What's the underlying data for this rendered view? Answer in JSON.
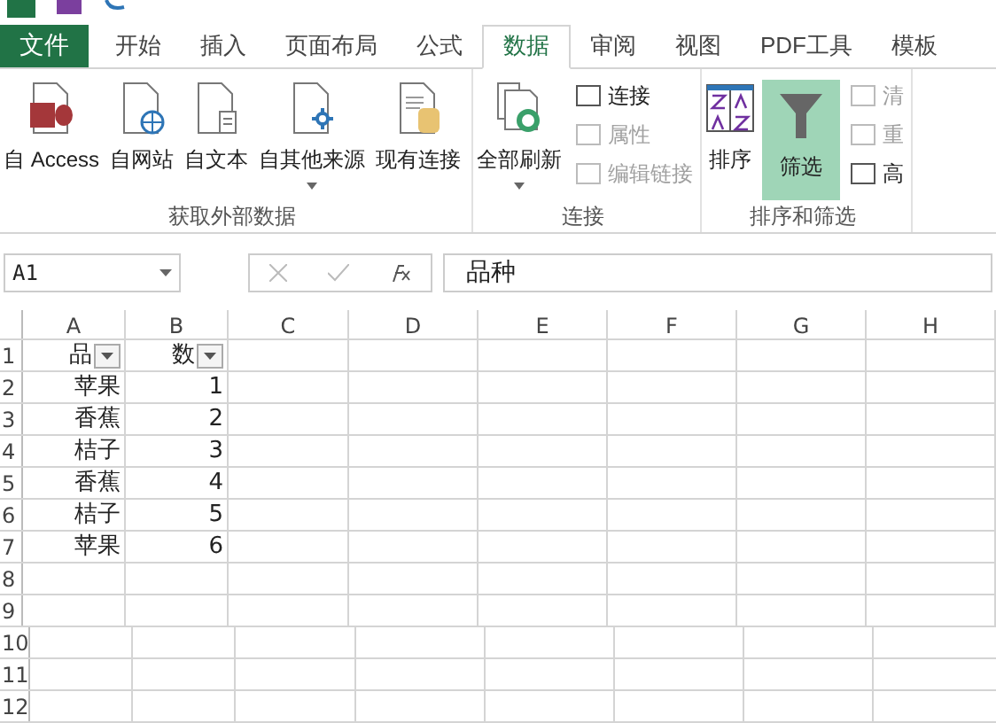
{
  "tabs": [
    {
      "label": "文件",
      "kind": "file",
      "selected": false
    },
    {
      "label": "开始",
      "kind": "tab",
      "selected": false
    },
    {
      "label": "插入",
      "kind": "tab",
      "selected": false
    },
    {
      "label": "页面布局",
      "kind": "tab",
      "selected": false
    },
    {
      "label": "公式",
      "kind": "tab",
      "selected": false
    },
    {
      "label": "数据",
      "kind": "tab",
      "selected": true
    },
    {
      "label": "审阅",
      "kind": "tab",
      "selected": false
    },
    {
      "label": "视图",
      "kind": "tab",
      "selected": false
    },
    {
      "label": "PDF工具",
      "kind": "tab",
      "selected": false
    },
    {
      "label": "模板",
      "kind": "tab",
      "selected": false
    }
  ],
  "ribbon": {
    "groups": [
      {
        "label": "获取外部数据",
        "buttons": [
          {
            "label": "自 Access",
            "dropdown": false
          },
          {
            "label": "自网站",
            "dropdown": false
          },
          {
            "label": "自文本",
            "dropdown": false
          },
          {
            "label": "自其他来源",
            "dropdown": true
          },
          {
            "label": "现有连接",
            "dropdown": false
          }
        ]
      },
      {
        "label": "连接",
        "buttons": [
          {
            "label": "全部刷新",
            "dropdown": true
          }
        ],
        "small": [
          {
            "label": "连接",
            "disabled": false
          },
          {
            "label": "属性",
            "disabled": true
          },
          {
            "label": "编辑链接",
            "disabled": true
          }
        ]
      },
      {
        "label": "排序和筛选",
        "buttons": [
          {
            "label": "排序",
            "dropdown": false,
            "selected": false
          },
          {
            "label": "筛选",
            "dropdown": false,
            "selected": true
          }
        ],
        "small": [
          {
            "label": "清",
            "disabled": true
          },
          {
            "label": "重",
            "disabled": true
          },
          {
            "label": "高",
            "disabled": false
          }
        ]
      }
    ]
  },
  "formula_bar": {
    "name_box": "A1",
    "value": "品种"
  },
  "sheet": {
    "columns": [
      "A",
      "B",
      "C",
      "D",
      "E",
      "F",
      "G",
      "H"
    ],
    "rows": [
      {
        "header": "1",
        "cells": [
          "品",
          "数"
        ],
        "filter": true
      },
      {
        "header": "2",
        "cells": [
          "苹果",
          "1"
        ]
      },
      {
        "header": "3",
        "cells": [
          "香蕉",
          "2"
        ]
      },
      {
        "header": "4",
        "cells": [
          "桔子",
          "3"
        ]
      },
      {
        "header": "5",
        "cells": [
          "香蕉",
          "4"
        ]
      },
      {
        "header": "6",
        "cells": [
          "桔子",
          "5"
        ]
      },
      {
        "header": "7",
        "cells": [
          "苹果",
          "6"
        ]
      },
      {
        "header": "8",
        "cells": []
      },
      {
        "header": "9",
        "cells": []
      },
      {
        "header": "10",
        "cells": []
      },
      {
        "header": "11",
        "cells": []
      },
      {
        "header": "12",
        "cells": []
      }
    ]
  }
}
